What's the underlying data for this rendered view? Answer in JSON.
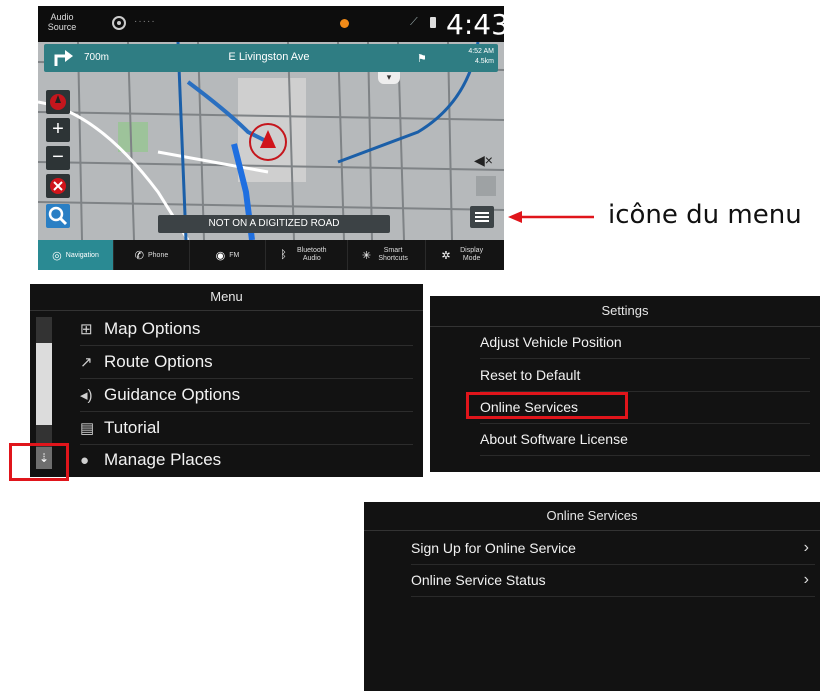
{
  "nav_screen": {
    "status": {
      "audio_source": "Audio Source",
      "clock": "4:43"
    },
    "guidance": {
      "distance": "700m",
      "street": "E Livingston Ave",
      "eta_time": "4:52 AM",
      "eta_distance": "4.5km"
    },
    "road_notice": "NOT ON A DIGITIZED ROAD",
    "tabs": [
      {
        "label": "Navigation",
        "icon": "navigation-icon"
      },
      {
        "label": "Phone",
        "icon": "phone-icon"
      },
      {
        "label": "FM",
        "icon": "radio-icon"
      },
      {
        "label": "Bluetooth Audio",
        "icon": "bluetooth-icon"
      },
      {
        "label": "Smart Shortcuts",
        "icon": "shortcuts-icon"
      },
      {
        "label": "Display Mode",
        "icon": "display-mode-icon"
      }
    ],
    "colors": {
      "accent": "#2a8a93",
      "route": "#1f6fe0",
      "marker": "#d0141b"
    }
  },
  "annotation": {
    "caption": "icône du menu",
    "arrow_color": "#e0151b"
  },
  "menu_panel": {
    "title": "Menu",
    "items": [
      {
        "label": "Map Options",
        "icon": "map-icon"
      },
      {
        "label": "Route Options",
        "icon": "route-icon"
      },
      {
        "label": "Guidance Options",
        "icon": "speaker-icon"
      },
      {
        "label": "Tutorial",
        "icon": "book-icon"
      },
      {
        "label": "Manage Places",
        "icon": "person-icon"
      }
    ]
  },
  "settings_panel": {
    "title": "Settings",
    "items": [
      {
        "label": "Adjust Vehicle Position"
      },
      {
        "label": "Reset to Default"
      },
      {
        "label": "Online Services"
      },
      {
        "label": "About Software License"
      }
    ]
  },
  "online_panel": {
    "title": "Online Services",
    "items": [
      {
        "label": "Sign Up for Online Service"
      },
      {
        "label": "Online Service Status"
      }
    ]
  }
}
